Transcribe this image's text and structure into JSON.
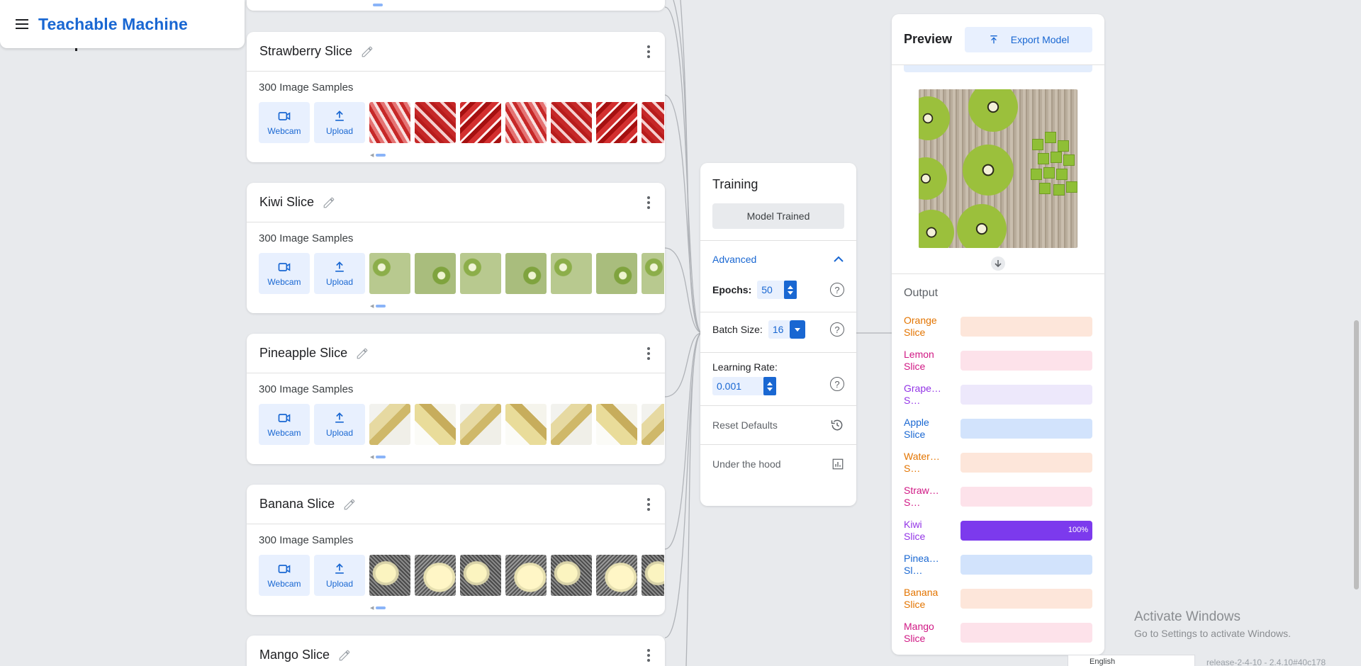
{
  "app": {
    "title": "Teachable Machine"
  },
  "classes": [
    {
      "name": "Strawberry Slice",
      "samples": "300 Image Samples",
      "webcam": "Webcam",
      "upload": "Upload"
    },
    {
      "name": "Kiwi Slice",
      "samples": "300 Image Samples",
      "webcam": "Webcam",
      "upload": "Upload"
    },
    {
      "name": "Pineapple Slice",
      "samples": "300 Image Samples",
      "webcam": "Webcam",
      "upload": "Upload"
    },
    {
      "name": "Banana Slice",
      "samples": "300 Image Samples",
      "webcam": "Webcam",
      "upload": "Upload"
    },
    {
      "name": "Mango Slice"
    }
  ],
  "training": {
    "title": "Training",
    "trained_label": "Model Trained",
    "advanced_label": "Advanced",
    "epochs_label": "Epochs:",
    "epochs_value": "50",
    "batch_label": "Batch Size:",
    "batch_value": "16",
    "lr_label": "Learning Rate:",
    "lr_value": "0.001",
    "help_glyph": "?",
    "reset_label": "Reset Defaults",
    "hood_label": "Under the hood"
  },
  "preview": {
    "title": "Preview",
    "export_label": "Export Model",
    "output_label": "Output",
    "outputs": [
      {
        "label": "Orange\nSlice",
        "color": "#e37400",
        "track": "#fde6da",
        "value": 0
      },
      {
        "label": "Lemon\nSlice",
        "color": "#d01884",
        "track": "#fde2ea",
        "value": 0
      },
      {
        "label": "Grape…\nS…",
        "color": "#9334e6",
        "track": "#ede8fb",
        "value": 0
      },
      {
        "label": "Apple\nSlice",
        "color": "#1967d2",
        "track": "#d2e3fc",
        "value": 0
      },
      {
        "label": "Water…\nS…",
        "color": "#e37400",
        "track": "#fde6da",
        "value": 0
      },
      {
        "label": "Straw…\nS…",
        "color": "#d01884",
        "track": "#fde2ea",
        "value": 0
      },
      {
        "label": "Kiwi\nSlice",
        "color": "#9334e6",
        "track": "#ede8fb",
        "fill": "#7c3aed",
        "value": 100,
        "percent": "100%"
      },
      {
        "label": "Pinea…\nSl…",
        "color": "#1967d2",
        "track": "#d2e3fc",
        "value": 0
      },
      {
        "label": "Banana\nSlice",
        "color": "#e37400",
        "track": "#fde6da",
        "value": 0
      },
      {
        "label": "Mango\nSlice",
        "color": "#d01884",
        "track": "#fde2ea",
        "value": 0
      }
    ]
  },
  "footer": {
    "activate_title": "Activate Windows",
    "activate_sub": "Go to Settings to activate Windows.",
    "language": "English",
    "release": "release-2-4-10 - 2.4.10#40c178"
  }
}
